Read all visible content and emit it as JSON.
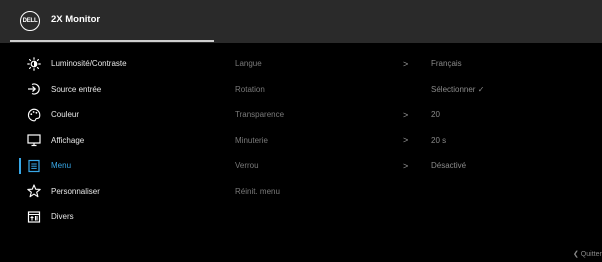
{
  "header": {
    "logo_text": "DELL",
    "title": "2X Monitor"
  },
  "menu": [
    {
      "label": "Luminosité/Contraste",
      "icon": "brightness-icon"
    },
    {
      "label": "Source entrée",
      "icon": "input-source-icon"
    },
    {
      "label": "Couleur",
      "icon": "color-palette-icon"
    },
    {
      "label": "Affichage",
      "icon": "display-icon"
    },
    {
      "label": "Menu",
      "icon": "menu-icon",
      "active": true
    },
    {
      "label": "Personnaliser",
      "icon": "star-icon"
    },
    {
      "label": "Divers",
      "icon": "others-icon"
    }
  ],
  "submenu": [
    {
      "label": "Langue",
      "arrow": ">",
      "value": "Français"
    },
    {
      "label": "Rotation",
      "arrow": "",
      "value": "Sélectionner ✓"
    },
    {
      "label": "Transparence",
      "arrow": ">",
      "value": "20"
    },
    {
      "label": "Minuterie",
      "arrow": ">",
      "value": "20 s"
    },
    {
      "label": "Verrou",
      "arrow": ">",
      "value": "Désactivé"
    },
    {
      "label": "Réinit. menu",
      "arrow": "",
      "value": ""
    }
  ],
  "footer": {
    "quit_label": "❮ Quitter"
  },
  "colors": {
    "accent": "#38a8e8",
    "header_bg": "#2a2a2a",
    "background": "#000000"
  }
}
